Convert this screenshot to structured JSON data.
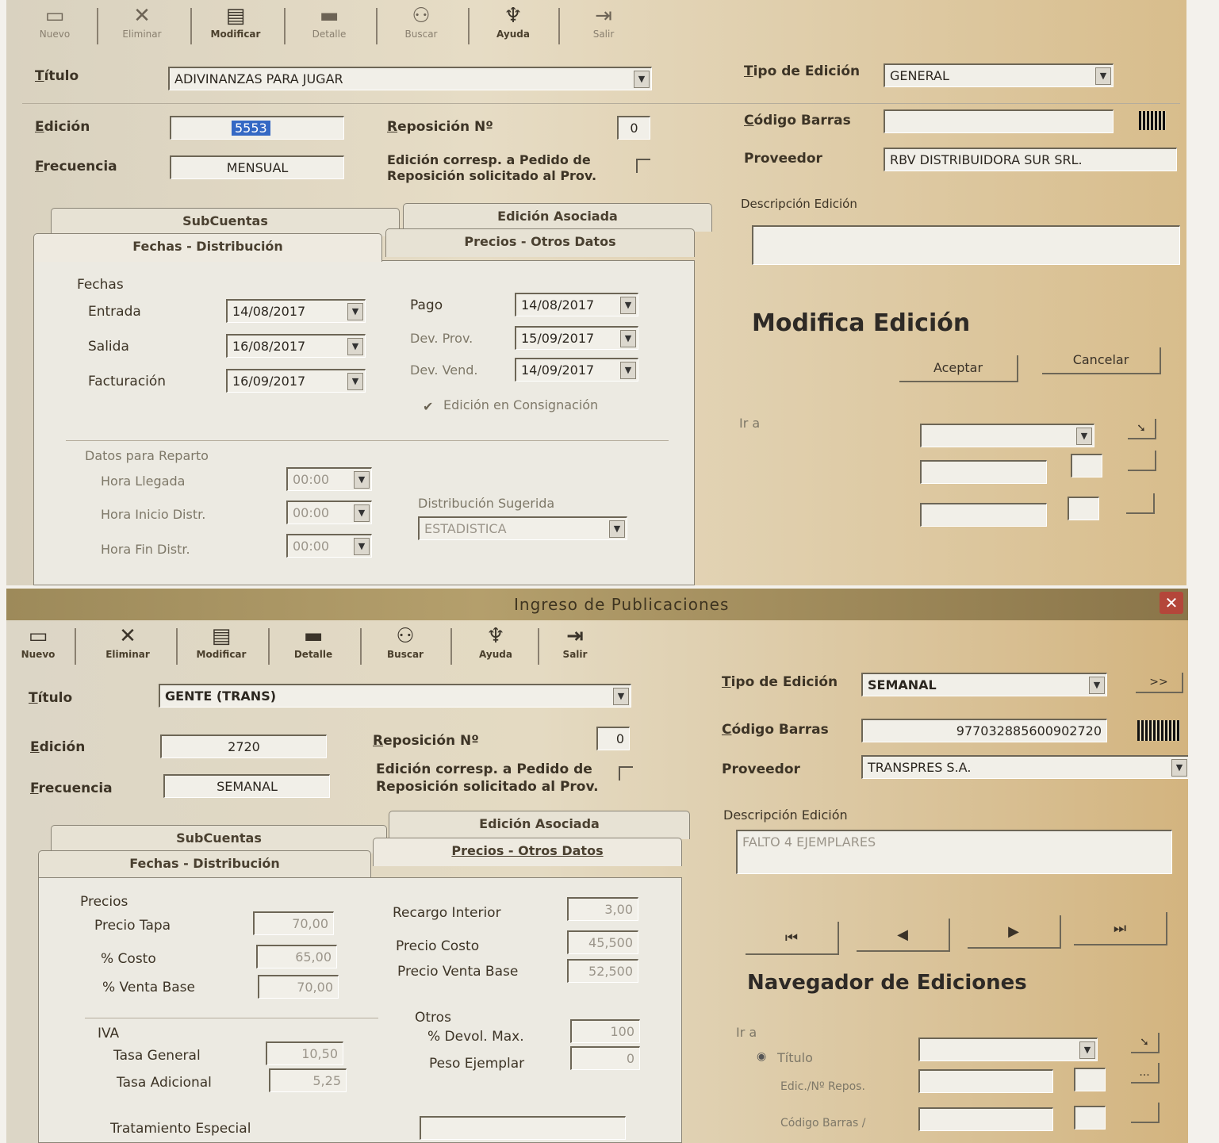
{
  "top": {
    "toolbar": [
      "Nuevo",
      "Eliminar",
      "Modificar",
      "Detalle",
      "Buscar",
      "Ayuda",
      "Salir"
    ],
    "titulo_label": "Título",
    "titulo_value": "ADIVINANZAS PARA JUGAR",
    "tipo_edicion_label": "Tipo de Edición",
    "tipo_edicion_value": "GENERAL",
    "edicion_label": "Edición",
    "edicion_value": "5553",
    "reposicion_label": "Reposición Nº",
    "reposicion_value": "0",
    "codigo_barras_label": "Código Barras",
    "codigo_barras_value": "",
    "frecuencia_label": "Frecuencia",
    "frecuencia_value": "MENSUAL",
    "pedido_label_1": "Edición corresp. a Pedido de",
    "pedido_label_2": "Reposición solicitado al Prov.",
    "proveedor_label": "Proveedor",
    "proveedor_value": "RBV DISTRIBUIDORA SUR SRL.",
    "descripcion_label": "Descripción Edición",
    "tabs": [
      "SubCuentas",
      "Edición Asociada",
      "Fechas - Distribución",
      "Precios - Otros Datos"
    ],
    "fechas_group": "Fechas",
    "entrada_label": "Entrada",
    "entrada_value": "14/08/2017",
    "salida_label": "Salida",
    "salida_value": "16/08/2017",
    "facturacion_label": "Facturación",
    "facturacion_value": "16/09/2017",
    "pago_label": "Pago",
    "pago_value": "14/08/2017",
    "dev_prov_label": "Dev. Prov.",
    "dev_prov_value": "15/09/2017",
    "dev_vend_label": "Dev. Vend.",
    "dev_vend_value": "14/09/2017",
    "consignacion_label": "Edición en Consignación",
    "reparto_group": "Datos para Reparto",
    "hora_llegada_label": "Hora Llegada",
    "hora_llegada_value": "00:00",
    "hora_inicio_label": "Hora Inicio Distr.",
    "hora_inicio_value": "00:00",
    "hora_fin_label": "Hora Fin Distr.",
    "hora_fin_value": "00:00",
    "dist_sugerida_label": "Distribución Sugerida",
    "dist_sugerida_value": "ESTADISTICA",
    "modifica_title": "Modifica Edición",
    "aceptar": "Aceptar",
    "cancelar": "Cancelar",
    "ir_a": "Ir a"
  },
  "bottom": {
    "window_title": "Ingreso de Publicaciones",
    "toolbar": [
      "Nuevo",
      "Eliminar",
      "Modificar",
      "Detalle",
      "Buscar",
      "Ayuda",
      "Salir"
    ],
    "titulo_label": "Título",
    "titulo_value": "GENTE (TRANS)",
    "tipo_edicion_label": "Tipo de Edición",
    "tipo_edicion_value": "SEMANAL",
    "next_button": ">>",
    "edicion_label": "Edición",
    "edicion_value": "2720",
    "reposicion_label": "Reposición Nº",
    "reposicion_value": "0",
    "codigo_barras_label": "Código Barras",
    "codigo_barras_value": "977032885600902720",
    "frecuencia_label": "Frecuencia",
    "frecuencia_value": "SEMANAL",
    "pedido_label_1": "Edición corresp. a Pedido de",
    "pedido_label_2": "Reposición solicitado al Prov.",
    "proveedor_label": "Proveedor",
    "proveedor_value": "TRANSPRES S.A.",
    "descripcion_label": "Descripción Edición",
    "descripcion_value": "FALTO 4 EJEMPLARES",
    "tabs": [
      "SubCuentas",
      "Edición Asociada",
      "Fechas - Distribución",
      "Precios - Otros Datos"
    ],
    "precios_group": "Precios",
    "precio_tapa_label": "Precio Tapa",
    "precio_tapa_value": "70,00",
    "costo_label": "% Costo",
    "costo_value": "65,00",
    "venta_base_label": "% Venta Base",
    "venta_base_value": "70,00",
    "recargo_label": "Recargo Interior",
    "recargo_value": "3,00",
    "precio_costo_label": "Precio Costo",
    "precio_costo_value": "45,500",
    "precio_venta_label": "Precio Venta Base",
    "precio_venta_value": "52,500",
    "iva_group": "IVA",
    "tasa_general_label": "Tasa General",
    "tasa_general_value": "10,50",
    "tasa_adicional_label": "Tasa Adicional",
    "tasa_adicional_value": "5,25",
    "otros_group": "Otros",
    "devol_label": "% Devol. Max.",
    "devol_value": "100",
    "peso_label": "Peso Ejemplar",
    "peso_value": "0",
    "tratamiento_label": "Tratamiento Especial",
    "nav_first": "⏮",
    "nav_prev": "◀",
    "nav_next": "▶",
    "nav_last": "⏭",
    "navegador_title": "Navegador de Ediciones",
    "ir_a": "Ir a",
    "opt_titulo": "Título",
    "opt_edic": "Edic./Nº Repos.",
    "opt_codigo": "Código Barras /",
    "dots": "..."
  }
}
